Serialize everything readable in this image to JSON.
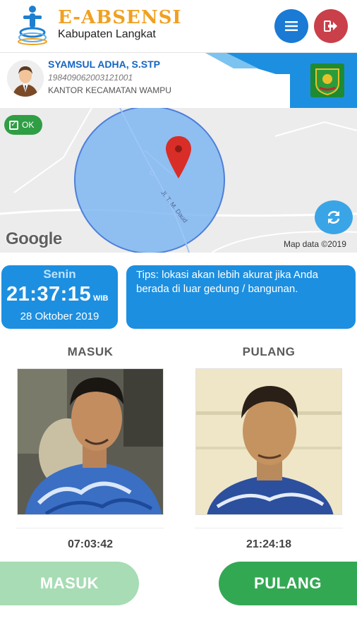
{
  "app": {
    "title": "E-ABSENSI",
    "subtitle": "Kabupaten Langkat"
  },
  "header": {
    "menu_icon": "hamburger-menu-icon",
    "logout_icon": "logout-icon",
    "menu_color": "#1a7ad4",
    "logout_color": "#c9404a"
  },
  "profile": {
    "name": "SYAMSUL ADHA, S.STP",
    "nip": "198409062003121001",
    "office": "KANTOR KECAMATAN WAMPU"
  },
  "map": {
    "status_label": "OK",
    "road_label": "Jl. T. M. Daud",
    "google_label": "Google",
    "attribution": "Map data ©2019",
    "refresh_icon": "refresh-icon"
  },
  "clock": {
    "day": "Senin",
    "time": "21:37:15",
    "timezone": "WIB",
    "date": "28 Oktober 2019"
  },
  "tips": {
    "text": "Tips: lokasi akan lebih akurat jika Anda berada di luar gedung / bangunan."
  },
  "attendance": {
    "masuk": {
      "label": "MASUK",
      "time": "07:03:42"
    },
    "pulang": {
      "label": "PULANG",
      "time": "21:24:18"
    }
  },
  "actions": {
    "masuk_button": "MASUK",
    "pulang_button": "PULANG",
    "masuk_color": "#a7dcb4",
    "pulang_color": "#33a853"
  },
  "colors": {
    "accent": "#1d8fe0",
    "brand": "#f0a020",
    "ok": "#2f9e44"
  }
}
